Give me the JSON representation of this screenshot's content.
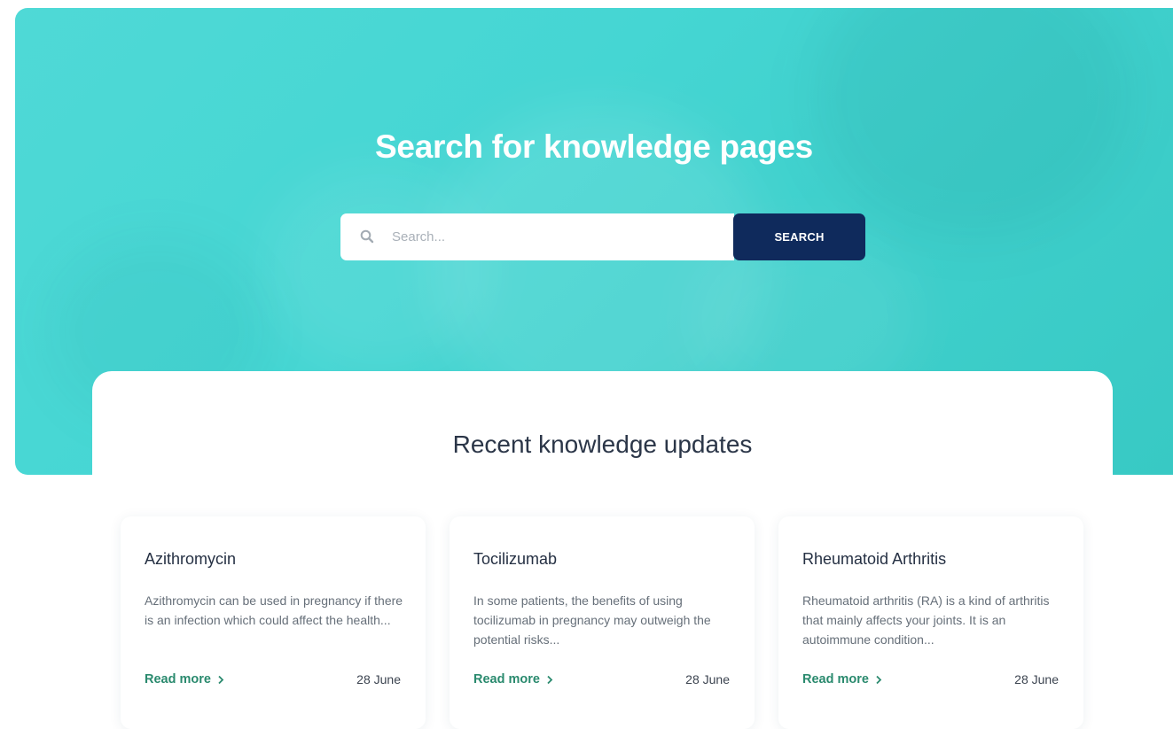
{
  "hero": {
    "title": "Search for knowledge pages",
    "search": {
      "placeholder": "Search...",
      "button_label": "SEARCH",
      "icon": "search-icon"
    }
  },
  "recent": {
    "title": "Recent knowledge updates",
    "cards": [
      {
        "title": "Azithromycin",
        "description": "Azithromycin can be used in pregnancy if there is an infection which could affect the health...",
        "link_label": "Read more",
        "date": "28 June"
      },
      {
        "title": "Tocilizumab",
        "description": "In some patients, the benefits of using tocilizumab in pregnancy may outweigh the potential risks...",
        "link_label": "Read more",
        "date": "28 June"
      },
      {
        "title": "Rheumatoid Arthritis",
        "description": "Rheumatoid arthritis (RA) is a kind of arthritis that mainly affects your joints. It is an autoimmune condition...",
        "link_label": "Read more",
        "date": "28 June"
      }
    ]
  },
  "colors": {
    "hero_bg": "#45d6d3",
    "button_bg": "#0f2a5c",
    "link": "#2a8a6e"
  }
}
